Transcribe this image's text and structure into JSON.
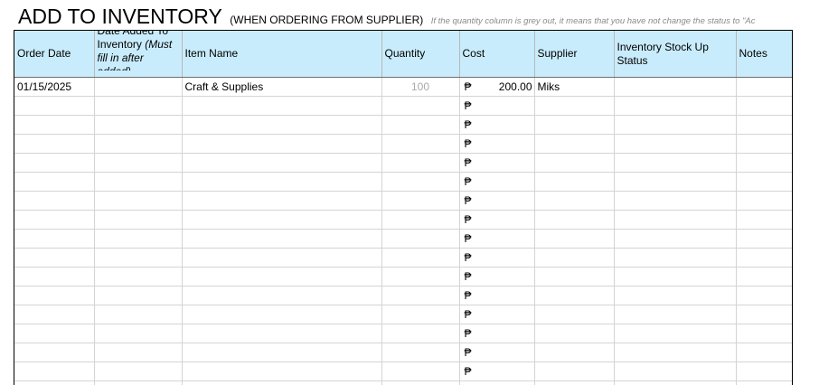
{
  "title": {
    "main": "ADD TO INVENTORY",
    "subtitle": "(WHEN ORDERING FROM SUPPLIER)",
    "note": "If the quantity column is grey out, it means that you have not change the status to \"Ac"
  },
  "table": {
    "headers": {
      "order_date": "Order Date",
      "date_added_plain": "Date Added To Inventory ",
      "date_added_italic": "(Must fill in after added)",
      "item_name": "Item Name",
      "quantity": "Quantity",
      "cost": "Cost",
      "supplier": "Supplier",
      "status": "Inventory Stock Up Status",
      "notes": "Notes"
    },
    "currency_symbol": "₱",
    "rows": [
      {
        "order_date": "01/15/2025",
        "date_added": "",
        "item": "Craft & Supplies",
        "quantity": "100",
        "cost": "200.00",
        "supplier": "Miks",
        "status": "",
        "notes": ""
      },
      {
        "order_date": "",
        "date_added": "",
        "item": "",
        "quantity": "",
        "cost": "",
        "supplier": "",
        "status": "",
        "notes": ""
      },
      {
        "order_date": "",
        "date_added": "",
        "item": "",
        "quantity": "",
        "cost": "",
        "supplier": "",
        "status": "",
        "notes": ""
      },
      {
        "order_date": "",
        "date_added": "",
        "item": "",
        "quantity": "",
        "cost": "",
        "supplier": "",
        "status": "",
        "notes": ""
      },
      {
        "order_date": "",
        "date_added": "",
        "item": "",
        "quantity": "",
        "cost": "",
        "supplier": "",
        "status": "",
        "notes": ""
      },
      {
        "order_date": "",
        "date_added": "",
        "item": "",
        "quantity": "",
        "cost": "",
        "supplier": "",
        "status": "",
        "notes": ""
      },
      {
        "order_date": "",
        "date_added": "",
        "item": "",
        "quantity": "",
        "cost": "",
        "supplier": "",
        "status": "",
        "notes": ""
      },
      {
        "order_date": "",
        "date_added": "",
        "item": "",
        "quantity": "",
        "cost": "",
        "supplier": "",
        "status": "",
        "notes": ""
      },
      {
        "order_date": "",
        "date_added": "",
        "item": "",
        "quantity": "",
        "cost": "",
        "supplier": "",
        "status": "",
        "notes": ""
      },
      {
        "order_date": "",
        "date_added": "",
        "item": "",
        "quantity": "",
        "cost": "",
        "supplier": "",
        "status": "",
        "notes": ""
      },
      {
        "order_date": "",
        "date_added": "",
        "item": "",
        "quantity": "",
        "cost": "",
        "supplier": "",
        "status": "",
        "notes": ""
      },
      {
        "order_date": "",
        "date_added": "",
        "item": "",
        "quantity": "",
        "cost": "",
        "supplier": "",
        "status": "",
        "notes": ""
      },
      {
        "order_date": "",
        "date_added": "",
        "item": "",
        "quantity": "",
        "cost": "",
        "supplier": "",
        "status": "",
        "notes": ""
      },
      {
        "order_date": "",
        "date_added": "",
        "item": "",
        "quantity": "",
        "cost": "",
        "supplier": "",
        "status": "",
        "notes": ""
      },
      {
        "order_date": "",
        "date_added": "",
        "item": "",
        "quantity": "",
        "cost": "",
        "supplier": "",
        "status": "",
        "notes": ""
      },
      {
        "order_date": "",
        "date_added": "",
        "item": "",
        "quantity": "",
        "cost": "",
        "supplier": "",
        "status": "",
        "notes": ""
      },
      {
        "order_date": "",
        "date_added": "",
        "item": "",
        "quantity": "",
        "cost": "",
        "supplier": "",
        "status": "",
        "notes": ""
      }
    ]
  },
  "colors": {
    "header_fill": "#c9ecfc",
    "grid_line": "#d4d4d4",
    "greyed_quantity": "#aaaaaa",
    "note_text": "#8a8a8a"
  }
}
